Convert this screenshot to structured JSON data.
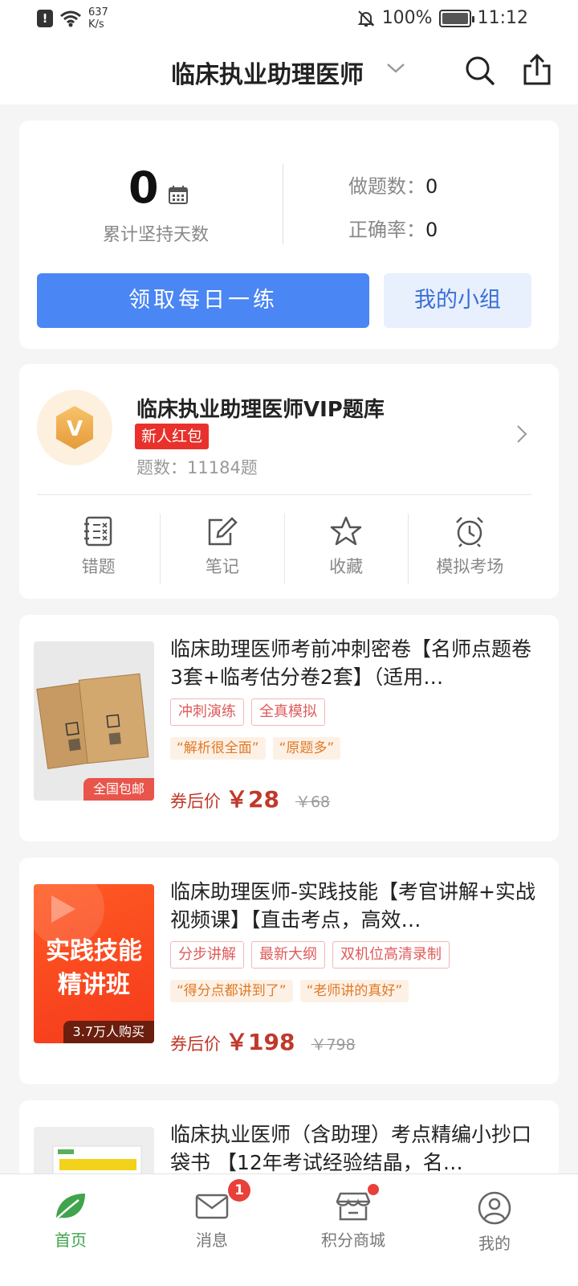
{
  "status_bar": {
    "net_speed_value": "637",
    "net_speed_unit": "K/s",
    "battery": "100%",
    "time": "11:12"
  },
  "header": {
    "title": "临床执业助理医师"
  },
  "stats": {
    "days_value": "0",
    "days_label": "累计坚持天数",
    "done_label": "做题数：",
    "done_value": "0",
    "accuracy_label": "正确率：",
    "accuracy_value": "0",
    "daily_button": "领取每日一练",
    "group_button": "我的小组"
  },
  "vip": {
    "badge_letter": "V",
    "title": "临床执业助理医师VIP题库",
    "tag": "新人红包",
    "count": "题数：11184题",
    "tools": [
      {
        "label": "错题",
        "icon": "wrong-questions-icon"
      },
      {
        "label": "笔记",
        "icon": "notes-icon"
      },
      {
        "label": "收藏",
        "icon": "favorite-star-icon"
      },
      {
        "label": "模拟考场",
        "icon": "alarm-clock-icon"
      }
    ]
  },
  "products": [
    {
      "title": "临床助理医师考前冲刺密卷【名师点题卷3套+临考估分卷2套】（适用…",
      "badge": "全国包邮",
      "tags": [
        "冲刺演练",
        "全真模拟"
      ],
      "quotes": [
        "“解析很全面”",
        "“原题多”"
      ],
      "price_label": "券后价",
      "price": "￥28",
      "original_price": "￥68"
    },
    {
      "title": "临床助理医师-实践技能【考官讲解+实战视频课】【直击考点，高效…",
      "thumb_line1": "实践技能",
      "thumb_line2": "精讲班",
      "badge": "3.7万人购买",
      "tags": [
        "分步讲解",
        "最新大纲",
        "双机位高清录制"
      ],
      "quotes": [
        "“得分点都讲到了”",
        "“老师讲的真好”"
      ],
      "price_label": "券后价",
      "price": "￥198",
      "original_price": "￥798"
    },
    {
      "title": "临床执业医师（含助理）考点精编小抄口袋书 【12年考试经验结晶，名…"
    }
  ],
  "bottom_nav": {
    "items": [
      {
        "label": "首页",
        "icon": "home-leaf-icon"
      },
      {
        "label": "消息",
        "icon": "mail-icon",
        "badge": "1"
      },
      {
        "label": "积分商城",
        "icon": "store-icon"
      },
      {
        "label": "我的",
        "icon": "profile-icon"
      }
    ]
  },
  "colors": {
    "primary_blue": "#4a86f4",
    "accent_red": "#e8312b",
    "price_red": "#c0392b",
    "nav_active_green": "#3fa44b"
  }
}
